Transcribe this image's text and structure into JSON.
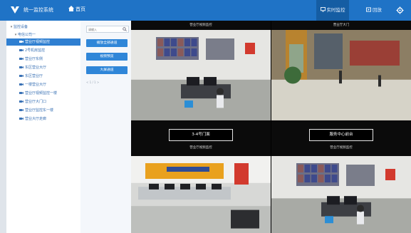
{
  "app": {
    "title": "统一监控系统",
    "home_label": "首页",
    "brand_color": "#1f73c6"
  },
  "topnav": {
    "items": [
      {
        "label": "实时监控",
        "active": true
      },
      {
        "label": "回放",
        "active": false
      }
    ]
  },
  "tree": {
    "root": "监控设备",
    "group": "电信公司一",
    "items": [
      "营业厅视频监控",
      "2号机房监控",
      "营业厅东侧",
      "东区营业大厅",
      "东区营业厅",
      "一楼营业大厅",
      "营业厅视频监控一楼",
      "营业厅大门口",
      "营业厅监控东一楼",
      "营业大厅走廊"
    ],
    "selected_index": 0
  },
  "panel": {
    "search_placeholder": "请输入",
    "buttons": [
      "播放全部通道",
      "视频预览",
      "大屏通道"
    ],
    "pager": "< 1 / 1 >"
  },
  "grid": {
    "cells": [
      {
        "caption": "营业厅视频监控",
        "type": "video",
        "scene": "office"
      },
      {
        "caption": "营业厅大门",
        "type": "video",
        "scene": "lobby"
      },
      {
        "caption": "营业厅视频监控",
        "type": "placeholder",
        "button": "3-4号门面"
      },
      {
        "caption": "营业厅视频监控",
        "type": "placeholder",
        "button": "服务中心前台"
      },
      {
        "caption": "",
        "type": "video",
        "scene": "reception"
      },
      {
        "caption": "",
        "type": "video",
        "scene": "office"
      }
    ]
  },
  "icons": [
    "logo-icon",
    "home-icon",
    "monitor-icon",
    "playback-icon",
    "gear-icon",
    "search-icon",
    "camera-icon"
  ]
}
